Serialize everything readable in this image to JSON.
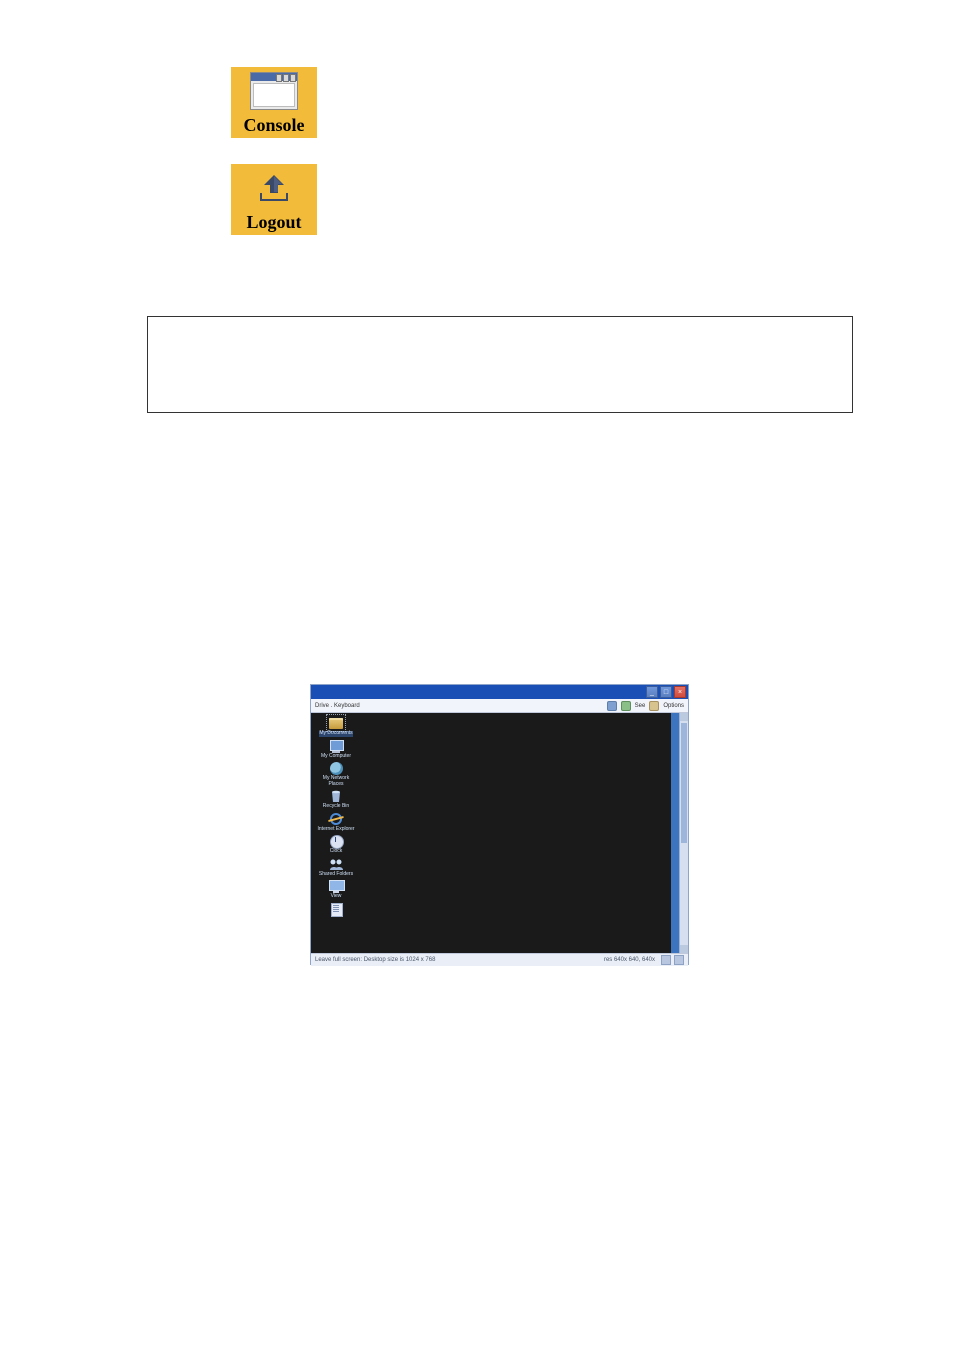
{
  "buttons": {
    "console": {
      "label": "Console"
    },
    "logout": {
      "label": "Logout"
    }
  },
  "screenshot": {
    "toolbar_left": "Drive . Keyboard",
    "toolbar_right_options": "Options",
    "sync_label": "See",
    "status_left": "Leave full screen: Desktop size is 1024 x 768",
    "status_right": "res 640x 640, 640x",
    "icons": [
      {
        "label": "My Documents"
      },
      {
        "label": "My Computer"
      },
      {
        "label": "My Network Places"
      },
      {
        "label": "Recycle Bin"
      },
      {
        "label": "Internet Explorer"
      },
      {
        "label": "Clock"
      },
      {
        "label": "Shared Folders"
      },
      {
        "label": "View"
      }
    ]
  }
}
